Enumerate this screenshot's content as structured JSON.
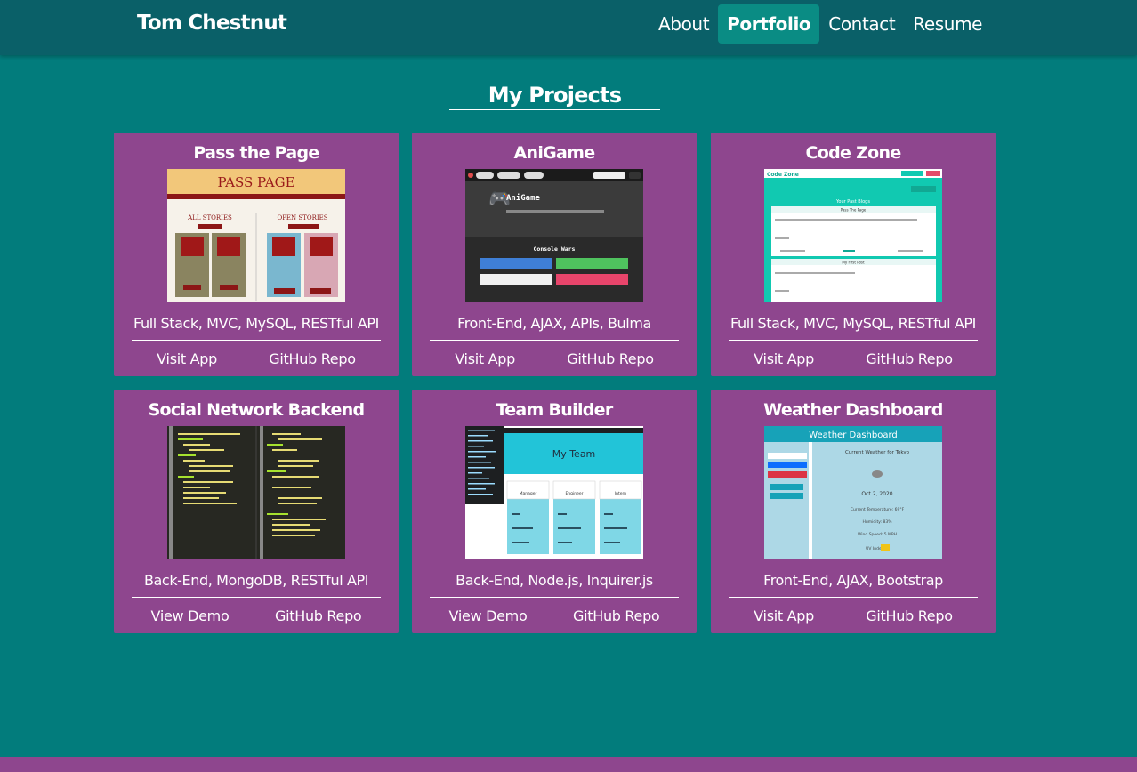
{
  "brand": "Tom Chestnut",
  "nav": {
    "items": [
      {
        "label": "About",
        "active": false
      },
      {
        "label": "Portfolio",
        "active": true
      },
      {
        "label": "Contact",
        "active": false
      },
      {
        "label": "Resume",
        "active": false
      }
    ]
  },
  "section_title": "My Projects",
  "projects": [
    {
      "title": "Pass the Page",
      "tech": "Full Stack, MVC, MySQL, RESTful API",
      "links": [
        "Visit App",
        "GitHub Repo"
      ],
      "thumb": {
        "logo": "PASS PAGE",
        "left_heading": "ALL STORIES",
        "right_heading": "OPEN STORIES"
      }
    },
    {
      "title": "AniGame",
      "tech": "Front-End, AJAX, APIs, Bulma",
      "links": [
        "Visit App",
        "GitHub Repo"
      ],
      "thumb": {
        "app_name": "AniGame",
        "subtitle": "Console Wars"
      }
    },
    {
      "title": "Code Zone",
      "tech": "Full Stack, MVC, MySQL, RESTful API",
      "links": [
        "Visit App",
        "GitHub Repo"
      ],
      "thumb": {
        "logo": "Code Zone",
        "heading": "Your Past Blogs",
        "post_title": "Pass The Page",
        "post_title_2": "My First Post"
      }
    },
    {
      "title": "Social Network Backend",
      "tech": "Back-End, MongoDB, RESTful API",
      "links": [
        "View Demo",
        "GitHub Repo"
      ]
    },
    {
      "title": "Team Builder",
      "tech": "Back-End, Node.js, Inquirer.js",
      "links": [
        "View Demo",
        "GitHub Repo"
      ],
      "thumb": {
        "heading": "My Team",
        "roles": [
          "Manager",
          "Engineer",
          "Intern"
        ]
      }
    },
    {
      "title": "Weather Dashboard",
      "tech": "Front-End, AJAX, Bootstrap",
      "links": [
        "Visit App",
        "GitHub Repo"
      ],
      "thumb": {
        "heading": "Weather Dashboard",
        "current": "Current Weather for Tokyo",
        "date": "Oct 2, 2020",
        "temp": "Current Temperature: 69°F",
        "humidity": "Humidity: 83%",
        "wind": "Wind Speed: 5 MPH",
        "uv": "UV Index:"
      }
    }
  ],
  "colors": {
    "background": "#027c7c",
    "navbar": "#0a6068",
    "card": "#8e468e",
    "active_nav": "#0a8c84"
  }
}
